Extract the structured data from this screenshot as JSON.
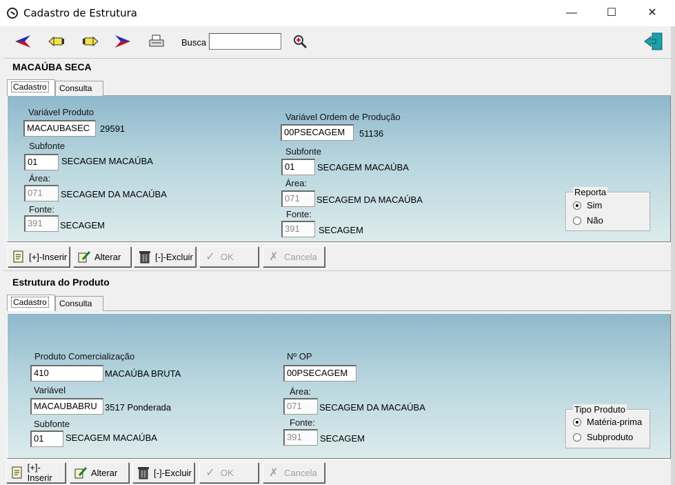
{
  "window": {
    "title": "Cadastro de Estrutura",
    "controls": {
      "minimize": "—",
      "maximize": "☐",
      "close": "✕"
    }
  },
  "toolbar": {
    "busca_label": "Busca",
    "busca_value": "",
    "icons": [
      "first-icon",
      "previous-icon",
      "next-icon",
      "last-icon",
      "print-icon",
      "search-zoom-icon",
      "exit-door-icon"
    ]
  },
  "top_section": {
    "title": "MACAÚBA SECA",
    "tabs": [
      "Cadastro",
      "Consulta"
    ],
    "variavel_produto_label": "Variável Produto",
    "variavel_produto_value": "MACAUBASEC",
    "variavel_produto_code": "29591",
    "subfonte_label": "Subfonte",
    "subfonte_value": "01",
    "subfonte_desc": "SECAGEM MACAÚBA",
    "area_label": "Área:",
    "area_value": "071",
    "area_desc": "SECAGEM DA MACAÚBA",
    "fonte_label": "Fonte:",
    "fonte_value": "391",
    "fonte_desc": "SECAGEM",
    "variavel_op_label": "Variável Ordem de Produção",
    "variavel_op_value": "00PSECAGEM",
    "variavel_op_code": "51136",
    "subfonte2_label": "Subfonte",
    "subfonte2_value": "01",
    "subfonte2_desc": "SECAGEM MACAÚBA",
    "area2_label": "Área:",
    "area2_value": "071",
    "area2_desc": "SECAGEM DA MACAÚBA",
    "fonte2_label": "Fonte:",
    "fonte2_value": "391",
    "fonte2_desc": "SECAGEM",
    "reporta": {
      "title": "Reporta",
      "options": [
        "Sim",
        "Não"
      ],
      "selected": "Sim"
    }
  },
  "top_actions": {
    "inserir": "[+]-Inserir",
    "alterar": "Alterar",
    "excluir": "[-]-Excluir",
    "ok": "OK",
    "cancela": "Cancela"
  },
  "bottom_section": {
    "title": "Estrutura do Produto",
    "tabs": [
      "Cadastro",
      "Consulta"
    ],
    "produto_label": "Produto Comercialização",
    "produto_value": "410",
    "produto_desc": "MACAÚBA BRUTA",
    "variavel_label": "Variável",
    "variavel_value": "MACAUBABRU",
    "variavel_desc": "3517 Ponderada",
    "subfonte_label": "Subfonte",
    "subfonte_value": "01",
    "subfonte_desc": "SECAGEM MACAÚBA",
    "nop_label": "Nº OP",
    "nop_value": "00PSECAGEM",
    "area_label": "Área:",
    "area_value": "071",
    "area_desc": "SECAGEM DA MACAÚBA",
    "fonte_label": "Fonte:",
    "fonte_value": "391",
    "fonte_desc": "SECAGEM",
    "tipo_produto": {
      "title": "Tipo Produto",
      "options": [
        "Matéria-prima",
        "Subproduto"
      ],
      "selected": "Matéria-prima"
    }
  },
  "bottom_actions": {
    "inserir": "[+]-Inserir",
    "alterar": "Alterar",
    "excluir": "[-]-Excluir",
    "ok": "OK",
    "cancela": "Cancela"
  }
}
